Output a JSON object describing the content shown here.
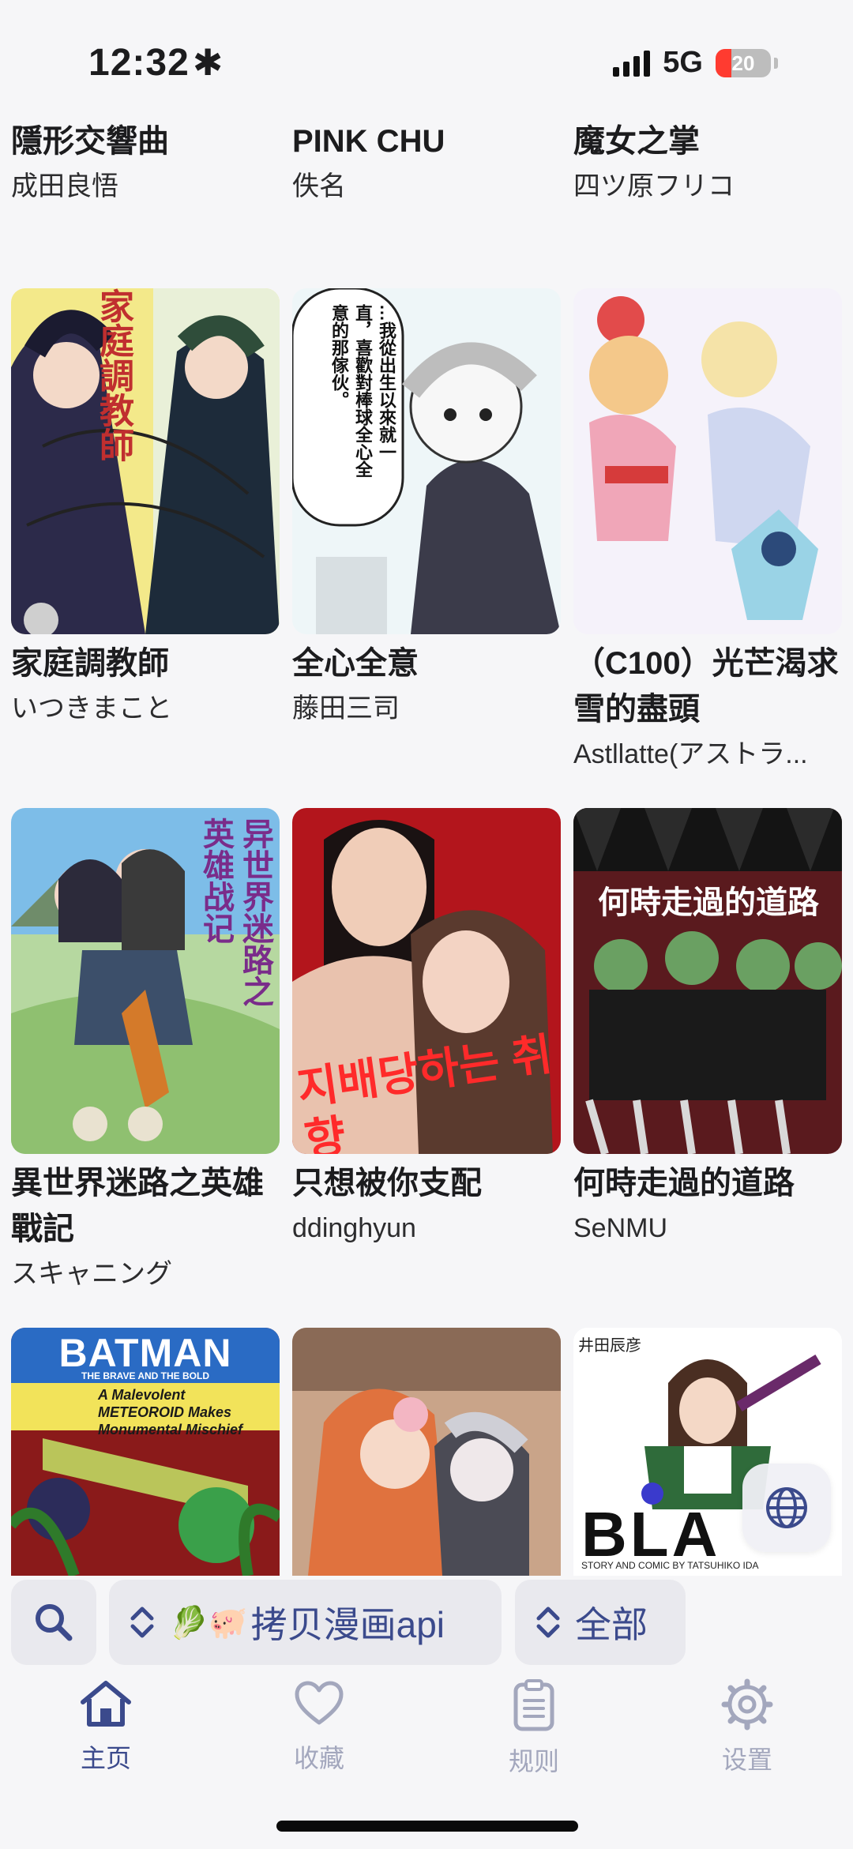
{
  "status_bar": {
    "time": "12:32",
    "network": "5G",
    "battery": "20"
  },
  "grid": {
    "top_row": [
      {
        "title": "隱形交響曲",
        "author": "成田良悟"
      },
      {
        "title": "PINK CHU",
        "author": "佚名"
      },
      {
        "title": "魔女之掌",
        "author": "四ツ原フリコ"
      }
    ],
    "row2": [
      {
        "title": "家庭調教師",
        "author": "いつきまこと"
      },
      {
        "title": "全心全意",
        "author": "藤田三司"
      },
      {
        "title": "（C100）光芒渴求雪的盡頭",
        "author": "Astllatte(アストラ..."
      }
    ],
    "row3": [
      {
        "title": "異世界迷路之英雄戰記",
        "author": "スキャニング"
      },
      {
        "title": "只想被你支配",
        "author": "ddinghyun"
      },
      {
        "title": "何時走過的道路",
        "author": "SeNMU"
      }
    ]
  },
  "covers": {
    "c1_text": "家庭調教師",
    "c2_text": "…我從出生以來就一直，喜歡對棒球全心全意的那傢伙。",
    "c4_text": "异世界迷路之英雄战记",
    "c5_text": "지배당하는 취향",
    "c6_text": "何時走過的道路",
    "c7_title": "BATMAN",
    "c7_subtitle": "THE BRAVE AND THE BOLD",
    "c7_blurb": "A Malevolent METEOROID Makes Monumental Mischief",
    "c9_author": "井田辰彦",
    "c9_title": "BLA",
    "c9_footer": "STORY AND COMIC BY TATSUHIKO IDA"
  },
  "filter_bar": {
    "source_emoji": "🥬🐖",
    "source_label": "拷贝漫画api",
    "category_label": "全部"
  },
  "tabs": [
    {
      "label": "主页"
    },
    {
      "label": "收藏"
    },
    {
      "label": "规则"
    },
    {
      "label": "设置"
    }
  ],
  "colors": {
    "accent": "#3b4a8c",
    "inactive": "#a3a7bd",
    "chip_bg": "#e9e9ee",
    "background": "#f6f6f8"
  }
}
